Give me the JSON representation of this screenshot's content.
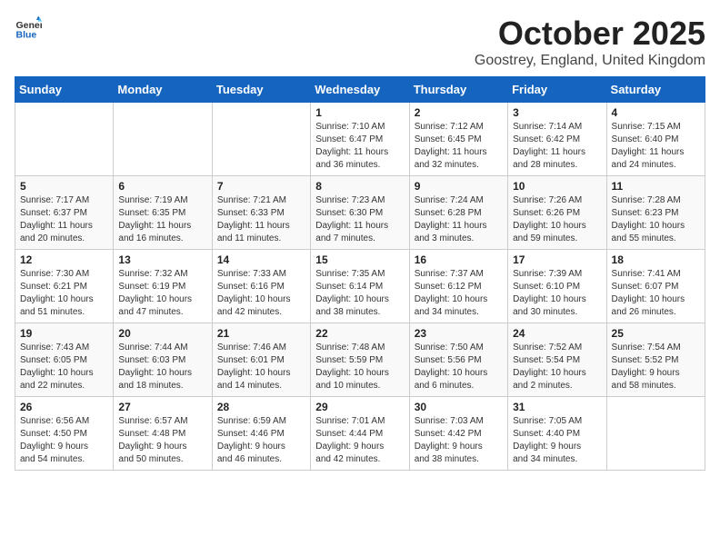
{
  "header": {
    "logo_general": "General",
    "logo_blue": "Blue",
    "month": "October 2025",
    "location": "Goostrey, England, United Kingdom"
  },
  "days_of_week": [
    "Sunday",
    "Monday",
    "Tuesday",
    "Wednesday",
    "Thursday",
    "Friday",
    "Saturday"
  ],
  "weeks": [
    [
      {
        "day": "",
        "info": ""
      },
      {
        "day": "",
        "info": ""
      },
      {
        "day": "",
        "info": ""
      },
      {
        "day": "1",
        "info": "Sunrise: 7:10 AM\nSunset: 6:47 PM\nDaylight: 11 hours\nand 36 minutes."
      },
      {
        "day": "2",
        "info": "Sunrise: 7:12 AM\nSunset: 6:45 PM\nDaylight: 11 hours\nand 32 minutes."
      },
      {
        "day": "3",
        "info": "Sunrise: 7:14 AM\nSunset: 6:42 PM\nDaylight: 11 hours\nand 28 minutes."
      },
      {
        "day": "4",
        "info": "Sunrise: 7:15 AM\nSunset: 6:40 PM\nDaylight: 11 hours\nand 24 minutes."
      }
    ],
    [
      {
        "day": "5",
        "info": "Sunrise: 7:17 AM\nSunset: 6:37 PM\nDaylight: 11 hours\nand 20 minutes."
      },
      {
        "day": "6",
        "info": "Sunrise: 7:19 AM\nSunset: 6:35 PM\nDaylight: 11 hours\nand 16 minutes."
      },
      {
        "day": "7",
        "info": "Sunrise: 7:21 AM\nSunset: 6:33 PM\nDaylight: 11 hours\nand 11 minutes."
      },
      {
        "day": "8",
        "info": "Sunrise: 7:23 AM\nSunset: 6:30 PM\nDaylight: 11 hours\nand 7 minutes."
      },
      {
        "day": "9",
        "info": "Sunrise: 7:24 AM\nSunset: 6:28 PM\nDaylight: 11 hours\nand 3 minutes."
      },
      {
        "day": "10",
        "info": "Sunrise: 7:26 AM\nSunset: 6:26 PM\nDaylight: 10 hours\nand 59 minutes."
      },
      {
        "day": "11",
        "info": "Sunrise: 7:28 AM\nSunset: 6:23 PM\nDaylight: 10 hours\nand 55 minutes."
      }
    ],
    [
      {
        "day": "12",
        "info": "Sunrise: 7:30 AM\nSunset: 6:21 PM\nDaylight: 10 hours\nand 51 minutes."
      },
      {
        "day": "13",
        "info": "Sunrise: 7:32 AM\nSunset: 6:19 PM\nDaylight: 10 hours\nand 47 minutes."
      },
      {
        "day": "14",
        "info": "Sunrise: 7:33 AM\nSunset: 6:16 PM\nDaylight: 10 hours\nand 42 minutes."
      },
      {
        "day": "15",
        "info": "Sunrise: 7:35 AM\nSunset: 6:14 PM\nDaylight: 10 hours\nand 38 minutes."
      },
      {
        "day": "16",
        "info": "Sunrise: 7:37 AM\nSunset: 6:12 PM\nDaylight: 10 hours\nand 34 minutes."
      },
      {
        "day": "17",
        "info": "Sunrise: 7:39 AM\nSunset: 6:10 PM\nDaylight: 10 hours\nand 30 minutes."
      },
      {
        "day": "18",
        "info": "Sunrise: 7:41 AM\nSunset: 6:07 PM\nDaylight: 10 hours\nand 26 minutes."
      }
    ],
    [
      {
        "day": "19",
        "info": "Sunrise: 7:43 AM\nSunset: 6:05 PM\nDaylight: 10 hours\nand 22 minutes."
      },
      {
        "day": "20",
        "info": "Sunrise: 7:44 AM\nSunset: 6:03 PM\nDaylight: 10 hours\nand 18 minutes."
      },
      {
        "day": "21",
        "info": "Sunrise: 7:46 AM\nSunset: 6:01 PM\nDaylight: 10 hours\nand 14 minutes."
      },
      {
        "day": "22",
        "info": "Sunrise: 7:48 AM\nSunset: 5:59 PM\nDaylight: 10 hours\nand 10 minutes."
      },
      {
        "day": "23",
        "info": "Sunrise: 7:50 AM\nSunset: 5:56 PM\nDaylight: 10 hours\nand 6 minutes."
      },
      {
        "day": "24",
        "info": "Sunrise: 7:52 AM\nSunset: 5:54 PM\nDaylight: 10 hours\nand 2 minutes."
      },
      {
        "day": "25",
        "info": "Sunrise: 7:54 AM\nSunset: 5:52 PM\nDaylight: 9 hours\nand 58 minutes."
      }
    ],
    [
      {
        "day": "26",
        "info": "Sunrise: 6:56 AM\nSunset: 4:50 PM\nDaylight: 9 hours\nand 54 minutes."
      },
      {
        "day": "27",
        "info": "Sunrise: 6:57 AM\nSunset: 4:48 PM\nDaylight: 9 hours\nand 50 minutes."
      },
      {
        "day": "28",
        "info": "Sunrise: 6:59 AM\nSunset: 4:46 PM\nDaylight: 9 hours\nand 46 minutes."
      },
      {
        "day": "29",
        "info": "Sunrise: 7:01 AM\nSunset: 4:44 PM\nDaylight: 9 hours\nand 42 minutes."
      },
      {
        "day": "30",
        "info": "Sunrise: 7:03 AM\nSunset: 4:42 PM\nDaylight: 9 hours\nand 38 minutes."
      },
      {
        "day": "31",
        "info": "Sunrise: 7:05 AM\nSunset: 4:40 PM\nDaylight: 9 hours\nand 34 minutes."
      },
      {
        "day": "",
        "info": ""
      }
    ]
  ]
}
